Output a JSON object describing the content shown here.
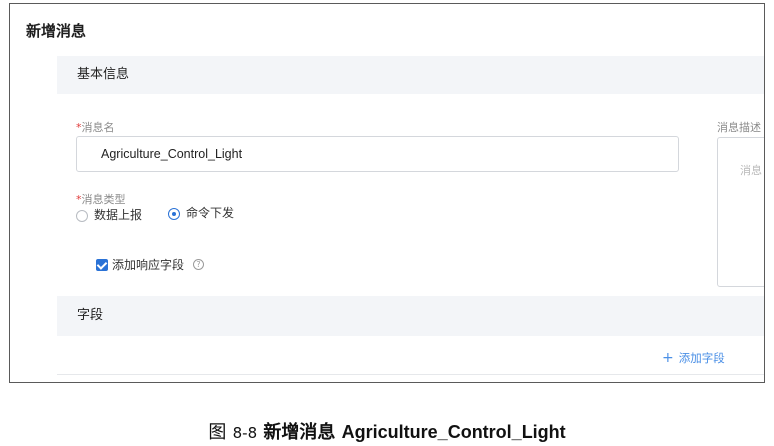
{
  "dialog": {
    "title": "新增消息"
  },
  "basic_info": {
    "section_title": "基本信息",
    "name": {
      "required_mark": "*",
      "label": "消息名",
      "value": "Agriculture_Control_Light"
    },
    "description": {
      "label": "消息描述",
      "placeholder": "消息"
    },
    "type": {
      "required_mark": "*",
      "label": "消息类型",
      "options": [
        {
          "label": "数据上报",
          "selected": false
        },
        {
          "label": "命令下发",
          "selected": true
        }
      ]
    },
    "response_fields": {
      "label": "添加响应字段",
      "checked": true,
      "help_icon": "question-circle-icon"
    }
  },
  "fields": {
    "section_title": "字段",
    "add_button": {
      "icon": "plus-icon",
      "label": "添加字段"
    }
  },
  "caption": {
    "fig": "图",
    "number": "8-8",
    "title_cn": "新增消息",
    "title_en": "Agriculture_Control_Light"
  },
  "colors": {
    "accent": "#2a72d6",
    "link": "#4a8fe6",
    "section_bg": "#f3f5f8",
    "required": "#e03b3b"
  }
}
